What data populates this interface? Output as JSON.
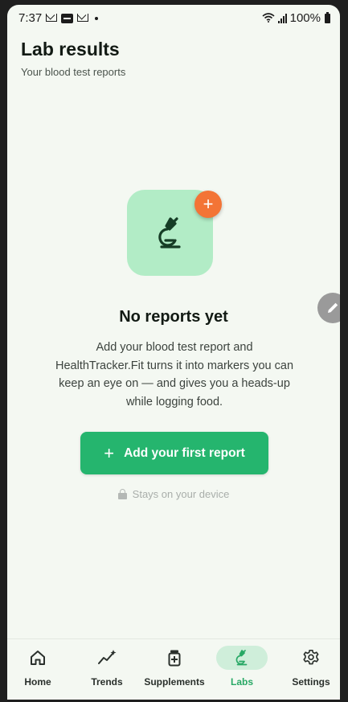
{
  "status_bar": {
    "time": "7:37",
    "battery": "100%",
    "icons": [
      "gmail-icon",
      "card-icon",
      "gmail-icon",
      "dot-icon",
      "wifi-icon",
      "signal-icon",
      "battery-icon"
    ]
  },
  "header": {
    "title": "Lab results",
    "subtitle": "Your blood test reports"
  },
  "empty_state": {
    "icon": "microscope-icon",
    "badge": "+",
    "title": "No reports yet",
    "description": "Add your blood test report and HealthTracker.Fit turns it into markers you can keep an eye on — and gives you a heads-up while logging food.",
    "button_label": "Add your first report",
    "button_icon": "+",
    "note": "Stays on your device"
  },
  "colors": {
    "accent": "#25b56e",
    "tile": "#b2ecc6",
    "badge": "#f37436",
    "background": "#f4f8f2"
  },
  "bottom_nav": {
    "items": [
      {
        "label": "Home",
        "icon": "home-icon"
      },
      {
        "label": "Trends",
        "icon": "trends-icon"
      },
      {
        "label": "Supplements",
        "icon": "supplements-icon"
      },
      {
        "label": "Labs",
        "icon": "microscope-icon",
        "active": true
      },
      {
        "label": "Settings",
        "icon": "gear-icon"
      }
    ]
  }
}
